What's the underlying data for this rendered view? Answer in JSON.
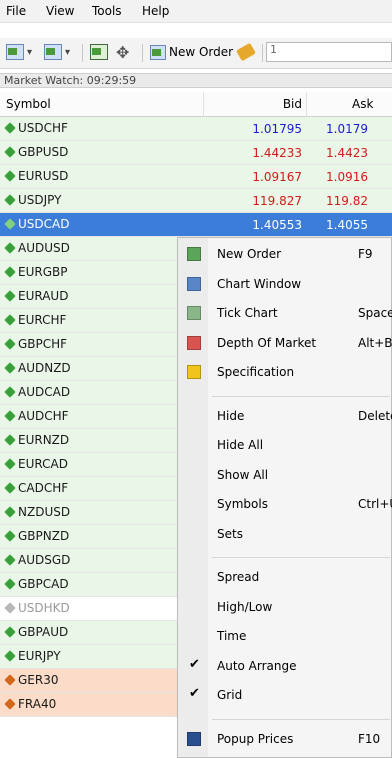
{
  "menu": [
    "File",
    "View",
    "Tools",
    "Help"
  ],
  "toolbar": {
    "new_order_label": "New Order",
    "input_value": "1"
  },
  "market_watch": {
    "title": "Market Watch: 09:29:59",
    "columns": {
      "symbol": "Symbol",
      "bid": "Bid",
      "ask": "Ask"
    },
    "rows": [
      {
        "symbol": "USDCHF",
        "bid": "1.01795",
        "ask": "1.0179",
        "bg": "#eaf6e8",
        "price_color": "#1b1bd1",
        "sym_color": "#1a1a1a",
        "icon": "#3b9f3b"
      },
      {
        "symbol": "GBPUSD",
        "bid": "1.44233",
        "ask": "1.4423",
        "bg": "#eaf6e8",
        "price_color": "#d11b1b",
        "sym_color": "#1a1a1a",
        "icon": "#3b9f3b"
      },
      {
        "symbol": "EURUSD",
        "bid": "1.09167",
        "ask": "1.0916",
        "bg": "#eaf6e8",
        "price_color": "#d11b1b",
        "sym_color": "#1a1a1a",
        "icon": "#3b9f3b"
      },
      {
        "symbol": "USDJPY",
        "bid": "119.827",
        "ask": "119.82",
        "bg": "#eaf6e8",
        "price_color": "#d11b1b",
        "sym_color": "#1a1a1a",
        "icon": "#3b9f3b"
      },
      {
        "symbol": "USDCAD",
        "bid": "1.40553",
        "ask": "1.4055",
        "bg": "#3b7dd8",
        "price_color": "#ffffff",
        "sym_color": "#ffffff",
        "icon": "#7fd07f"
      },
      {
        "symbol": "AUDUSD",
        "bid": "",
        "ask": "",
        "bg": "#eaf6e8",
        "price_color": "#1a1a1a",
        "sym_color": "#1a1a1a",
        "icon": "#3b9f3b"
      },
      {
        "symbol": "EURGBP",
        "bid": "",
        "ask": "",
        "bg": "#eaf6e8",
        "price_color": "#1a1a1a",
        "sym_color": "#1a1a1a",
        "icon": "#3b9f3b"
      },
      {
        "symbol": "EURAUD",
        "bid": "",
        "ask": "",
        "bg": "#eaf6e8",
        "price_color": "#1a1a1a",
        "sym_color": "#1a1a1a",
        "icon": "#3b9f3b"
      },
      {
        "symbol": "EURCHF",
        "bid": "",
        "ask": "",
        "bg": "#eaf6e8",
        "price_color": "#1a1a1a",
        "sym_color": "#1a1a1a",
        "icon": "#3b9f3b"
      },
      {
        "symbol": "GBPCHF",
        "bid": "",
        "ask": "",
        "bg": "#eaf6e8",
        "price_color": "#1a1a1a",
        "sym_color": "#1a1a1a",
        "icon": "#3b9f3b"
      },
      {
        "symbol": "AUDNZD",
        "bid": "",
        "ask": "",
        "bg": "#eaf6e8",
        "price_color": "#1a1a1a",
        "sym_color": "#1a1a1a",
        "icon": "#3b9f3b"
      },
      {
        "symbol": "AUDCAD",
        "bid": "",
        "ask": "",
        "bg": "#eaf6e8",
        "price_color": "#1a1a1a",
        "sym_color": "#1a1a1a",
        "icon": "#3b9f3b"
      },
      {
        "symbol": "AUDCHF",
        "bid": "",
        "ask": "",
        "bg": "#eaf6e8",
        "price_color": "#1a1a1a",
        "sym_color": "#1a1a1a",
        "icon": "#3b9f3b"
      },
      {
        "symbol": "EURNZD",
        "bid": "",
        "ask": "",
        "bg": "#eaf6e8",
        "price_color": "#1a1a1a",
        "sym_color": "#1a1a1a",
        "icon": "#3b9f3b"
      },
      {
        "symbol": "EURCAD",
        "bid": "",
        "ask": "",
        "bg": "#eaf6e8",
        "price_color": "#1a1a1a",
        "sym_color": "#1a1a1a",
        "icon": "#3b9f3b"
      },
      {
        "symbol": "CADCHF",
        "bid": "",
        "ask": "",
        "bg": "#eaf6e8",
        "price_color": "#1a1a1a",
        "sym_color": "#1a1a1a",
        "icon": "#3b9f3b"
      },
      {
        "symbol": "NZDUSD",
        "bid": "",
        "ask": "",
        "bg": "#eaf6e8",
        "price_color": "#1a1a1a",
        "sym_color": "#1a1a1a",
        "icon": "#3b9f3b"
      },
      {
        "symbol": "GBPNZD",
        "bid": "",
        "ask": "",
        "bg": "#eaf6e8",
        "price_color": "#1a1a1a",
        "sym_color": "#1a1a1a",
        "icon": "#3b9f3b"
      },
      {
        "symbol": "AUDSGD",
        "bid": "",
        "ask": "",
        "bg": "#eaf6e8",
        "price_color": "#1a1a1a",
        "sym_color": "#1a1a1a",
        "icon": "#3b9f3b"
      },
      {
        "symbol": "GBPCAD",
        "bid": "",
        "ask": "",
        "bg": "#eaf6e8",
        "price_color": "#1a1a1a",
        "sym_color": "#1a1a1a",
        "icon": "#3b9f3b"
      },
      {
        "symbol": "USDHKD",
        "bid": "",
        "ask": "",
        "bg": "#ffffff",
        "price_color": "#9a9a9a",
        "sym_color": "#9a9a9a",
        "icon": "#b8b8b8"
      },
      {
        "symbol": "GBPAUD",
        "bid": "",
        "ask": "",
        "bg": "#eaf6e8",
        "price_color": "#1a1a1a",
        "sym_color": "#1a1a1a",
        "icon": "#3b9f3b"
      },
      {
        "symbol": "EURJPY",
        "bid": "",
        "ask": "",
        "bg": "#eaf6e8",
        "price_color": "#1a1a1a",
        "sym_color": "#1a1a1a",
        "icon": "#3b9f3b"
      },
      {
        "symbol": "GER30",
        "bid": "",
        "ask": "",
        "bg": "#fbdcc8",
        "price_color": "#1a1a1a",
        "sym_color": "#1a1a1a",
        "icon": "#d0681e"
      },
      {
        "symbol": "FRA40",
        "bid": "",
        "ask": "",
        "bg": "#fbdcc8",
        "price_color": "#1a1a1a",
        "sym_color": "#1a1a1a",
        "icon": "#d0681e"
      }
    ]
  },
  "context_menu": {
    "items": [
      {
        "label": "New Order",
        "shortcut": "F9",
        "icon": "new-order-icon",
        "icon_color": "#5ba55b",
        "check": false,
        "sep_before": false
      },
      {
        "label": "Chart Window",
        "shortcut": "",
        "icon": "chart-window-icon",
        "icon_color": "#5a86c8",
        "check": false,
        "sep_before": false
      },
      {
        "label": "Tick Chart",
        "shortcut": "Space",
        "icon": "tick-chart-icon",
        "icon_color": "#8ab78a",
        "check": false,
        "sep_before": false
      },
      {
        "label": "Depth Of Market",
        "shortcut": "Alt+B",
        "icon": "depth-of-market-icon",
        "icon_color": "#d9534f",
        "check": false,
        "sep_before": false
      },
      {
        "label": "Specification",
        "shortcut": "",
        "icon": "specification-icon",
        "icon_color": "#f0c419",
        "check": false,
        "sep_before": false
      },
      {
        "label": "Hide",
        "shortcut": "Delete",
        "icon": "",
        "icon_color": "",
        "check": false,
        "sep_before": true
      },
      {
        "label": "Hide All",
        "shortcut": "",
        "icon": "",
        "icon_color": "",
        "check": false,
        "sep_before": false
      },
      {
        "label": "Show All",
        "shortcut": "",
        "icon": "",
        "icon_color": "",
        "check": false,
        "sep_before": false
      },
      {
        "label": "Symbols",
        "shortcut": "Ctrl+U",
        "icon": "",
        "icon_color": "",
        "check": false,
        "sep_before": false
      },
      {
        "label": "Sets",
        "shortcut": "",
        "icon": "",
        "icon_color": "",
        "check": false,
        "sep_before": false
      },
      {
        "label": "Spread",
        "shortcut": "",
        "icon": "",
        "icon_color": "",
        "check": false,
        "sep_before": true
      },
      {
        "label": "High/Low",
        "shortcut": "",
        "icon": "",
        "icon_color": "",
        "check": false,
        "sep_before": false
      },
      {
        "label": "Time",
        "shortcut": "",
        "icon": "",
        "icon_color": "",
        "check": false,
        "sep_before": false
      },
      {
        "label": "Auto Arrange",
        "shortcut": "",
        "icon": "",
        "icon_color": "",
        "check": true,
        "sep_before": false
      },
      {
        "label": "Grid",
        "shortcut": "",
        "icon": "",
        "icon_color": "",
        "check": true,
        "sep_before": false
      },
      {
        "label": "Popup Prices",
        "shortcut": "F10",
        "icon": "popup-prices-icon",
        "icon_color": "#2a4f8f",
        "check": false,
        "sep_before": true
      }
    ]
  }
}
